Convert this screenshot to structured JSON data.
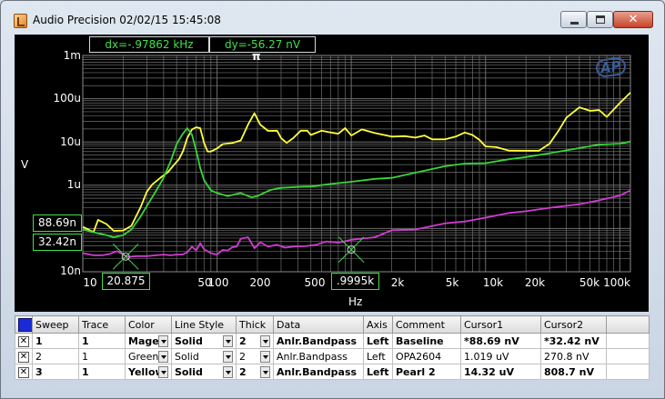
{
  "window": {
    "title": "Audio Precision  02/02/15 15:45:08"
  },
  "graph": {
    "dx_readout": "dx=-.97862 kHz",
    "dy_readout": "dy=-56.27  nV",
    "cursor_mark": "π",
    "logo_text": "AP",
    "y_unit": "V",
    "x_unit": "Hz",
    "y_ticks": [
      "1m",
      "100u",
      "10u",
      "1u",
      "100n",
      "10n"
    ],
    "x_ticks": [
      "10",
      "50",
      "100",
      "200",
      "500",
      "2k",
      "5k",
      "10k",
      "20k",
      "50k",
      "100k"
    ],
    "cursor1_y_value": "88.69n",
    "cursor2_y_value": "32.42n",
    "cursor1_x_value": "20.875",
    "cursor2_x_value": ".9995k",
    "colors": {
      "background": "#000000",
      "grid": "#6e6e6e",
      "yellow": "#ffff3c",
      "green": "#37d637",
      "magenta": "#d23cd2",
      "box_border": "#3ee14a"
    }
  },
  "chart_data": {
    "type": "line",
    "x_scale": "log",
    "y_scale": "log",
    "xlim": [
      10,
      120000
    ],
    "ylim": [
      1e-08,
      0.001
    ],
    "x_label": "Hz",
    "y_label": "V",
    "grid": true,
    "series": [
      {
        "color": "#ffff3c",
        "x": [
          10,
          11,
          12,
          13,
          15,
          17,
          20,
          23,
          27,
          30,
          33,
          38,
          43,
          48,
          52,
          56,
          60,
          65,
          70,
          75,
          80,
          85,
          90,
          100,
          110,
          130,
          150,
          170,
          190,
          210,
          240,
          280,
          300,
          330,
          370,
          420,
          470,
          500,
          600,
          700,
          800,
          900,
          1000,
          1200,
          1500,
          2000,
          2500,
          3000,
          3500,
          4000,
          5000,
          6000,
          7000,
          8000,
          9000,
          10000,
          12000,
          15000,
          20000,
          25000,
          30000,
          35000,
          40000,
          50000,
          60000,
          70000,
          80000,
          100000,
          120000
        ],
        "values": [
          1.09e-07,
          9.5e-08,
          8.2e-08,
          1.58e-07,
          1.27e-07,
          8.8e-08,
          9e-08,
          1.15e-07,
          3.15e-07,
          7.08e-07,
          1.05e-06,
          1.5e-06,
          2e-06,
          3e-06,
          3.98e-06,
          6.3e-06,
          1.23e-05,
          1.95e-05,
          2.19e-05,
          2.09e-05,
          9.55e-06,
          6.03e-06,
          6.03e-06,
          7.08e-06,
          8.9e-06,
          9.5e-06,
          1.08e-05,
          2.51e-05,
          4.61e-05,
          2.51e-05,
          1.8e-05,
          1.82e-05,
          1.23e-05,
          9.55e-06,
          1.23e-05,
          1.82e-05,
          1.82e-05,
          1.45e-05,
          1.82e-05,
          1.66e-05,
          1.55e-05,
          2.09e-05,
          1.41e-05,
          1.95e-05,
          1.61e-05,
          1.33e-05,
          1.36e-05,
          1.26e-05,
          1.41e-05,
          1.15e-05,
          1.15e-05,
          1.33e-05,
          1.65e-05,
          1.45e-05,
          1.12e-05,
          7.94e-06,
          7.59e-06,
          6.31e-06,
          6.3e-06,
          6.3e-06,
          9.12e-06,
          1.82e-05,
          3.63e-05,
          6.31e-05,
          5.25e-05,
          5.5e-05,
          3.8e-05,
          7.94e-05,
          0.000138
        ]
      },
      {
        "color": "#37d637",
        "x": [
          10,
          12,
          15,
          17,
          20,
          23,
          27,
          30,
          35,
          40,
          45,
          50,
          55,
          60,
          65,
          70,
          75,
          80,
          90,
          100,
          120,
          150,
          180,
          200,
          250,
          300,
          400,
          500,
          700,
          1000,
          1500,
          2000,
          3000,
          5000,
          7000,
          10000,
          15000,
          20000,
          30000,
          50000,
          70000,
          100000,
          120000
        ],
        "values": [
          9.5e-08,
          8.2e-08,
          7e-08,
          6.3e-08,
          7e-08,
          9.5e-08,
          1.91e-07,
          3.31e-07,
          7.24e-07,
          1.5e-06,
          3.5e-06,
          8.91e-06,
          1.48e-05,
          2.09e-05,
          1.48e-05,
          6.3e-06,
          2.51e-06,
          1.32e-06,
          7.59e-07,
          6.61e-07,
          5.62e-07,
          6.61e-07,
          5.25e-07,
          5.62e-07,
          7.76e-07,
          8.71e-07,
          9.12e-07,
          9.33e-07,
          1.07e-06,
          1.2e-06,
          1.4e-06,
          1.48e-06,
          1.95e-06,
          2.75e-06,
          3.16e-06,
          3.24e-06,
          3.98e-06,
          4.47e-06,
          5.5e-06,
          7.24e-06,
          8.7e-06,
          9.12e-06,
          1.02e-05
        ]
      },
      {
        "color": "#d23cd2",
        "x": [
          10,
          12,
          14,
          16,
          18,
          20,
          22,
          25,
          30,
          35,
          40,
          45,
          50,
          55,
          60,
          65,
          70,
          75,
          80,
          90,
          100,
          110,
          120,
          130,
          140,
          150,
          170,
          190,
          210,
          240,
          280,
          320,
          370,
          450,
          550,
          650,
          800,
          1000,
          1500,
          2000,
          3000,
          5000,
          7000,
          10000,
          15000,
          20000,
          30000,
          50000,
          70000,
          100000,
          120000
        ],
        "values": [
          2.7e-08,
          2.4e-08,
          2.4e-08,
          2.6e-08,
          3e-08,
          2.5e-08,
          2.2e-08,
          2.3e-08,
          2.3e-08,
          2.4e-08,
          2.5e-08,
          2.4e-08,
          2.5e-08,
          2.5e-08,
          2.8e-08,
          3.8e-08,
          3.1e-08,
          4.6e-08,
          3.3e-08,
          2.7e-08,
          2.5e-08,
          3.2e-08,
          3.1e-08,
          3.7e-08,
          3.8e-08,
          5.8e-08,
          6.3e-08,
          3.5e-08,
          4.8e-08,
          3.8e-08,
          4.2e-08,
          3.6e-08,
          3.8e-08,
          3.9e-08,
          4.2e-08,
          5e-08,
          4.7e-08,
          5.5e-08,
          6.3e-08,
          9.1e-08,
          9.5e-08,
          1.32e-07,
          1.45e-07,
          1.78e-07,
          2.29e-07,
          2.51e-07,
          3.01e-07,
          3.63e-07,
          4.47e-07,
          5.75e-07,
          7.59e-07
        ]
      }
    ],
    "cursors": [
      {
        "x": 20.875,
        "y": 2.242e-08
      },
      {
        "x": 999.5,
        "y": 3.242e-08
      }
    ]
  },
  "table": {
    "headers": [
      "",
      "Sweep",
      "Trace",
      "Color",
      "Line Style",
      "Thick",
      "Data",
      "Axis",
      "Comment",
      "Cursor1",
      "Cursor2",
      ""
    ],
    "rows": [
      {
        "check": "✕",
        "sweep": "1",
        "trace": "1",
        "color": "Magenta",
        "line_style": "Solid",
        "thick": "2",
        "data": "Anlr.Bandpass",
        "axis": "Left",
        "comment": "Baseline",
        "cursor1": "*88.69  nV",
        "cursor2": "*32.42  nV",
        "bold": true
      },
      {
        "check": "✕",
        "sweep": "2",
        "trace": "1",
        "color": "Green",
        "line_style": "Solid",
        "thick": "2",
        "data": "Anlr.Bandpass",
        "axis": "Left",
        "comment": "OPA2604",
        "cursor1": "1.019  uV",
        "cursor2": "270.8  nV",
        "bold": false
      },
      {
        "check": "✕",
        "sweep": "3",
        "trace": "1",
        "color": "Yellow",
        "line_style": "Solid",
        "thick": "2",
        "data": "Anlr.Bandpass",
        "axis": "Left",
        "comment": "Pearl 2",
        "cursor1": "14.32  uV",
        "cursor2": "808.7  nV",
        "bold": true
      }
    ]
  }
}
